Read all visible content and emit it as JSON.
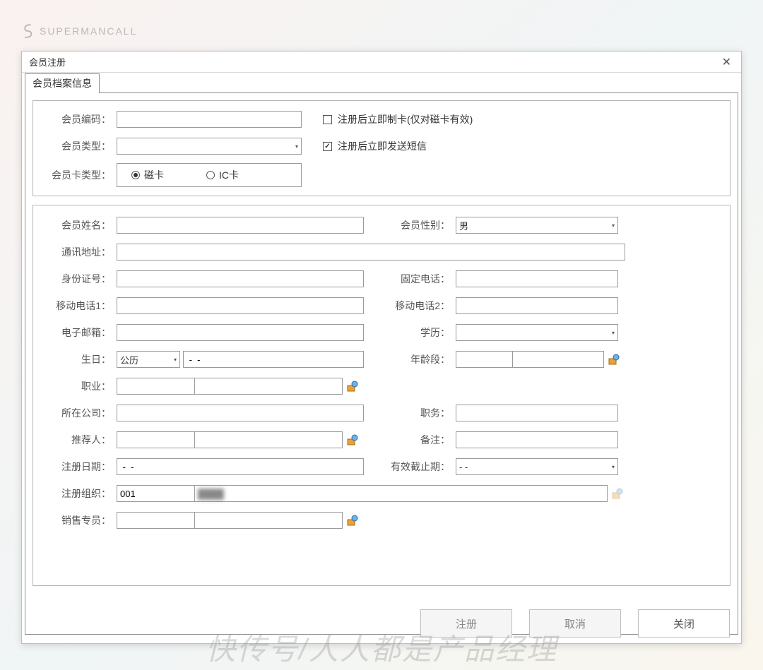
{
  "brand": "SUPERMANCALL",
  "window": {
    "title": "会员注册"
  },
  "tabs": {
    "profile": "会员档案信息"
  },
  "top": {
    "member_code_label": "会员编码：",
    "member_code_value": "",
    "member_type_label": "会员类型：",
    "member_type_value": "",
    "card_type_label": "会员卡类型：",
    "card_type_options": {
      "magnetic": "磁卡",
      "ic": "IC卡"
    },
    "card_type_selected": "magnetic",
    "chk_make_card_label": "注册后立即制卡(仅对磁卡有效)",
    "chk_make_card_checked": false,
    "chk_send_sms_label": "注册后立即发送短信",
    "chk_send_sms_checked": true
  },
  "main": {
    "name_label": "会员姓名：",
    "name_value": "",
    "gender_label": "会员性别：",
    "gender_value": "男",
    "address_label": "通讯地址：",
    "address_value": "",
    "idnum_label": "身份证号：",
    "idnum_value": "",
    "fixed_phone_label": "固定电话：",
    "fixed_phone_value": "",
    "mobile1_label": "移动电话1：",
    "mobile1_value": "",
    "mobile2_label": "移动电话2：",
    "mobile2_value": "",
    "email_label": "电子邮箱：",
    "email_value": "",
    "education_label": "学历：",
    "education_value": "",
    "birthday_label": "生日：",
    "birthday_calendar_value": "公历",
    "birthday_date_value": " -  - ",
    "age_range_label": "年龄段：",
    "age_range_a": "",
    "age_range_b": "",
    "occupation_label": "职业：",
    "occupation_a": "",
    "occupation_b": "",
    "company_label": "所在公司：",
    "company_value": "",
    "position_label": "职务：",
    "position_value": "",
    "referrer_label": "推荐人：",
    "referrer_a": "",
    "referrer_b": "",
    "remark_label": "备注：",
    "remark_value": "",
    "reg_date_label": "注册日期：",
    "reg_date_value": " -  - ",
    "expire_label": "有效截止期：",
    "expire_value": " -  - ",
    "reg_org_label": "注册组织：",
    "reg_org_code": "001",
    "reg_org_name": "████",
    "sales_label": "销售专员：",
    "sales_a": "",
    "sales_b": ""
  },
  "buttons": {
    "register": "注册",
    "cancel": "取消",
    "close": "关闭"
  },
  "watermark": "快传号/人人都是产品经理"
}
